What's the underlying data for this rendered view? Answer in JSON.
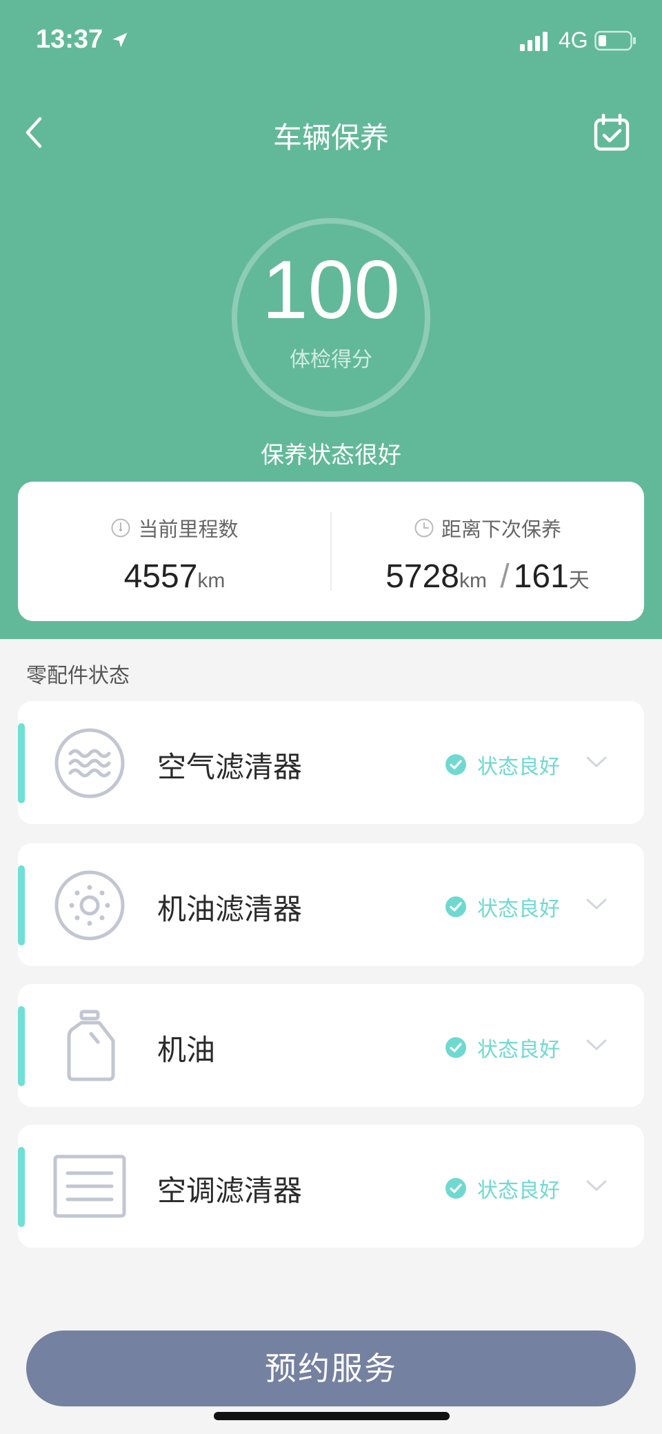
{
  "status_bar": {
    "time": "13:37",
    "network": "4G"
  },
  "nav": {
    "title": "车辆保养",
    "back_icon": "chevron-left-icon",
    "calendar_icon": "calendar-check-icon"
  },
  "score": {
    "value": "100",
    "label": "体检得分",
    "status": "保养状态很好"
  },
  "mileage_card": {
    "current": {
      "label": "当前里程数",
      "value": "4557",
      "unit": "km",
      "icon": "gauge-icon"
    },
    "next_service": {
      "label": "距离下次保养",
      "distance": "5728",
      "distance_unit": "km",
      "separator": "/",
      "days": "161",
      "days_unit": "天",
      "icon": "clock-icon"
    }
  },
  "parts_section": {
    "title": "零配件状态",
    "items": [
      {
        "name": "空气滤清器",
        "status": "状态良好",
        "icon": "air-filter-icon"
      },
      {
        "name": "机油滤清器",
        "status": "状态良好",
        "icon": "oil-filter-icon"
      },
      {
        "name": "机油",
        "status": "状态良好",
        "icon": "oil-bottle-icon"
      },
      {
        "name": "空调滤清器",
        "status": "状态良好",
        "icon": "ac-filter-icon"
      }
    ]
  },
  "actions": {
    "book_label": "预约服务"
  },
  "colors": {
    "header_bg": "#62b99a",
    "accent": "#6ee0d5",
    "button_bg": "#7581a0"
  }
}
